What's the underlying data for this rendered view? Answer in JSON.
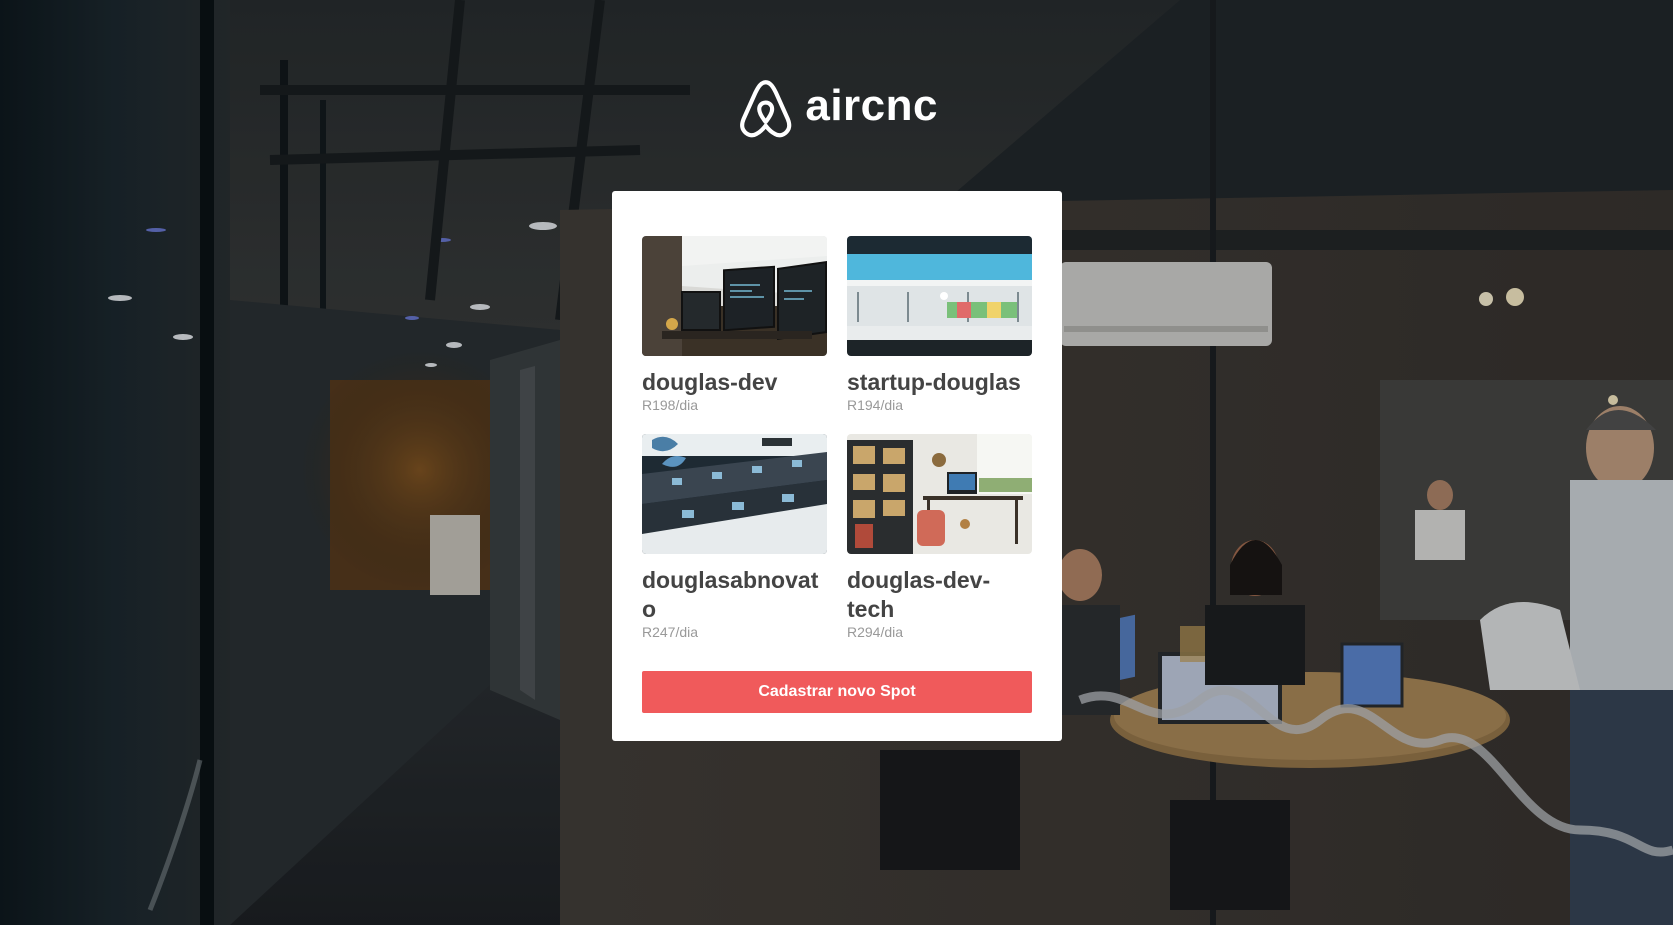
{
  "brand": {
    "name": "aircnc",
    "logo_icon": "airbnb-belo-icon",
    "primary_color": "#f05a5b",
    "text_color": "#444444",
    "muted_color": "#999999"
  },
  "background": {
    "description_icon": "office-background-photo"
  },
  "spots": [
    {
      "name": "douglas-dev",
      "price": "R198/dia",
      "thumbnail_icon": "desk-monitors-photo"
    },
    {
      "name": "startup-douglas",
      "price": "R194/dia",
      "thumbnail_icon": "open-office-photo"
    },
    {
      "name": "douglasabnovato",
      "price": "R247/dia",
      "thumbnail_icon": "coworking-desks-photo"
    },
    {
      "name": "douglas-dev-tech",
      "price": "R294/dia",
      "thumbnail_icon": "home-office-photo"
    }
  ],
  "actions": {
    "new_spot_label": "Cadastrar novo Spot"
  }
}
